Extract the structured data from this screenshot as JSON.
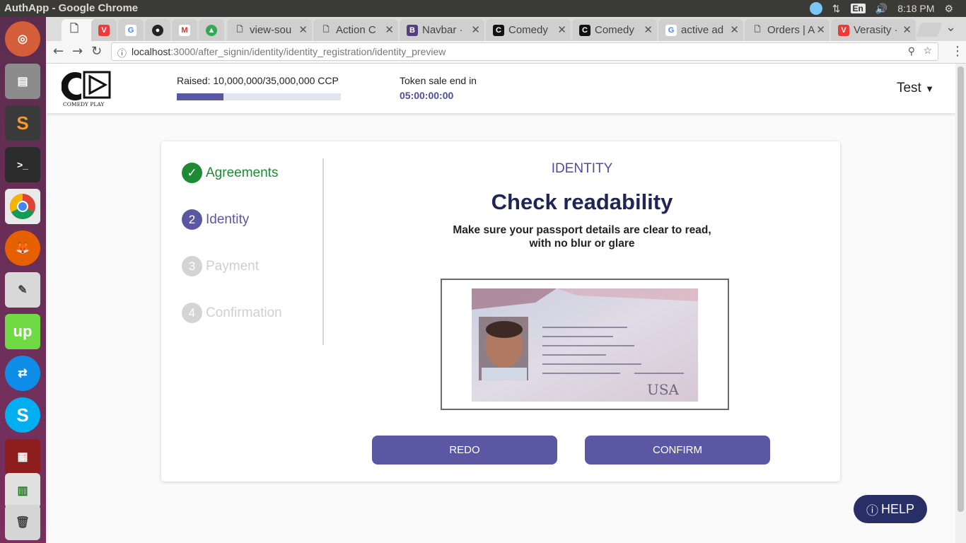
{
  "system": {
    "window_title": "AuthApp - Google Chrome",
    "lang": "En",
    "clock": "8:18 PM"
  },
  "tabs": [
    {
      "label": "",
      "favicon": "page-icon"
    },
    {
      "label": "",
      "favicon": "vivaldi-icon"
    },
    {
      "label": "",
      "favicon": "google-icon"
    },
    {
      "label": "",
      "favicon": "github-icon"
    },
    {
      "label": "",
      "favicon": "gmail-icon"
    },
    {
      "label": "",
      "favicon": "drive-icon"
    },
    {
      "label": "view-sou",
      "favicon": "page-icon"
    },
    {
      "label": "Action C",
      "favicon": "page-icon"
    },
    {
      "label": "Navbar ·",
      "favicon": "bootstrap-icon"
    },
    {
      "label": "Comedy",
      "favicon": "comedy-icon"
    },
    {
      "label": "Comedy",
      "favicon": "comedy-icon"
    },
    {
      "label": "active ad",
      "favicon": "google-icon"
    },
    {
      "label": "Orders | A",
      "favicon": "page-icon"
    },
    {
      "label": "Verasity ·",
      "favicon": "vivaldi-icon"
    }
  ],
  "omnibox": {
    "host": "localhost",
    "path": ":3000/after_signin/identity/identity_registration/identity_preview"
  },
  "header": {
    "logo_text": "COMEDY PLAY",
    "raised_label": "Raised: 10,000,000/35,000,000 CCP",
    "raised_fraction": 0.2857,
    "sale_label": "Token sale end in",
    "sale_time": "05:00:00:00",
    "user": "Test"
  },
  "steps": [
    {
      "num": "",
      "label": "Agreements",
      "state": "done"
    },
    {
      "num": "2",
      "label": "Identity",
      "state": "active"
    },
    {
      "num": "3",
      "label": "Payment",
      "state": "pending"
    },
    {
      "num": "4",
      "label": "Confirmation",
      "state": "pending"
    }
  ],
  "main": {
    "section": "IDENTITY",
    "title": "Check readability",
    "subtitle_line1": "Make sure your passport details are clear to read,",
    "subtitle_line2": "with no blur or glare",
    "passport_text": "USA",
    "redo_label": "REDO",
    "confirm_label": "CONFIRM"
  },
  "help_label": "HELP",
  "colors": {
    "primary": "#5a58a3",
    "done": "#1f8a34",
    "pending": "#d4d4d4",
    "dark": "#282e66"
  }
}
